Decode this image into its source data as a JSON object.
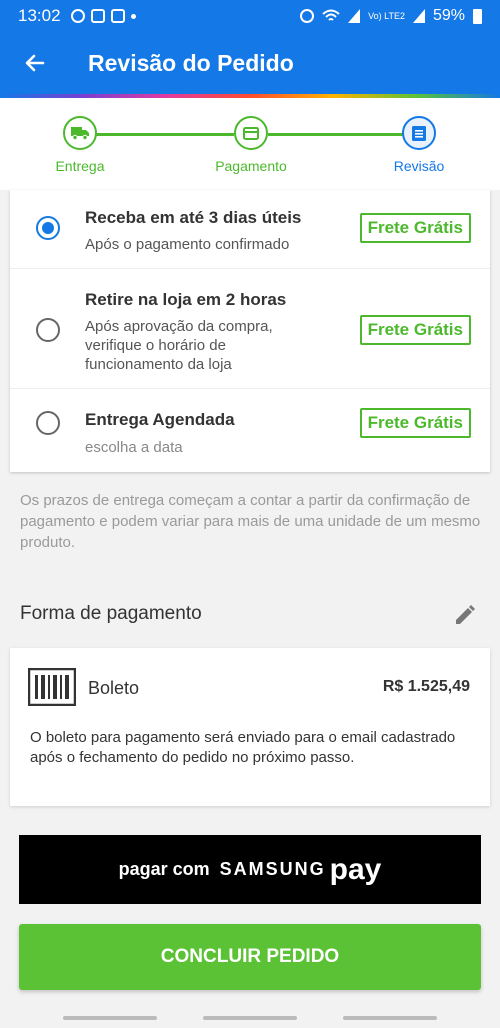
{
  "status_bar": {
    "time": "13:02",
    "network": "Vo) LTE2",
    "battery": "59%"
  },
  "header": {
    "title": "Revisão do Pedido"
  },
  "stepper": {
    "steps": [
      {
        "label": "Entrega",
        "icon": "truck-icon",
        "state": "done"
      },
      {
        "label": "Pagamento",
        "icon": "card-icon",
        "state": "done"
      },
      {
        "label": "Revisão",
        "icon": "document-icon",
        "state": "active"
      }
    ]
  },
  "delivery": {
    "options": [
      {
        "title": "Receba em até 3 dias úteis",
        "subtitle": "Após o pagamento confirmado",
        "badge": "Frete Grátis",
        "selected": true
      },
      {
        "title": "Retire na loja em 2 horas",
        "subtitle": "Após aprovação da compra, verifique o horário de funcionamento da loja",
        "badge": "Frete Grátis",
        "selected": false
      },
      {
        "title": "Entrega Agendada",
        "subtitle": "escolha a data",
        "badge": "Frete Grátis",
        "selected": false
      }
    ],
    "note": "Os prazos de entrega começam a contar a partir da confirmação de pagamento e podem variar para mais de uma unidade de um mesmo produto."
  },
  "payment": {
    "section_title": "Forma de pagamento",
    "method": "Boleto",
    "amount": "R$ 1.525,49",
    "description": "O boleto para pagamento será enviado para o email cadastrado após o fechamento do pedido no próximo passo."
  },
  "samsung_pay": {
    "prefix": "pagar com",
    "brand": "SAMSUNG",
    "suffix": "pay"
  },
  "actions": {
    "confirm_label": "CONCLUIR PEDIDO"
  },
  "colors": {
    "primary": "#1478e6",
    "success": "#4cb92d",
    "button_green": "#5bc236"
  }
}
